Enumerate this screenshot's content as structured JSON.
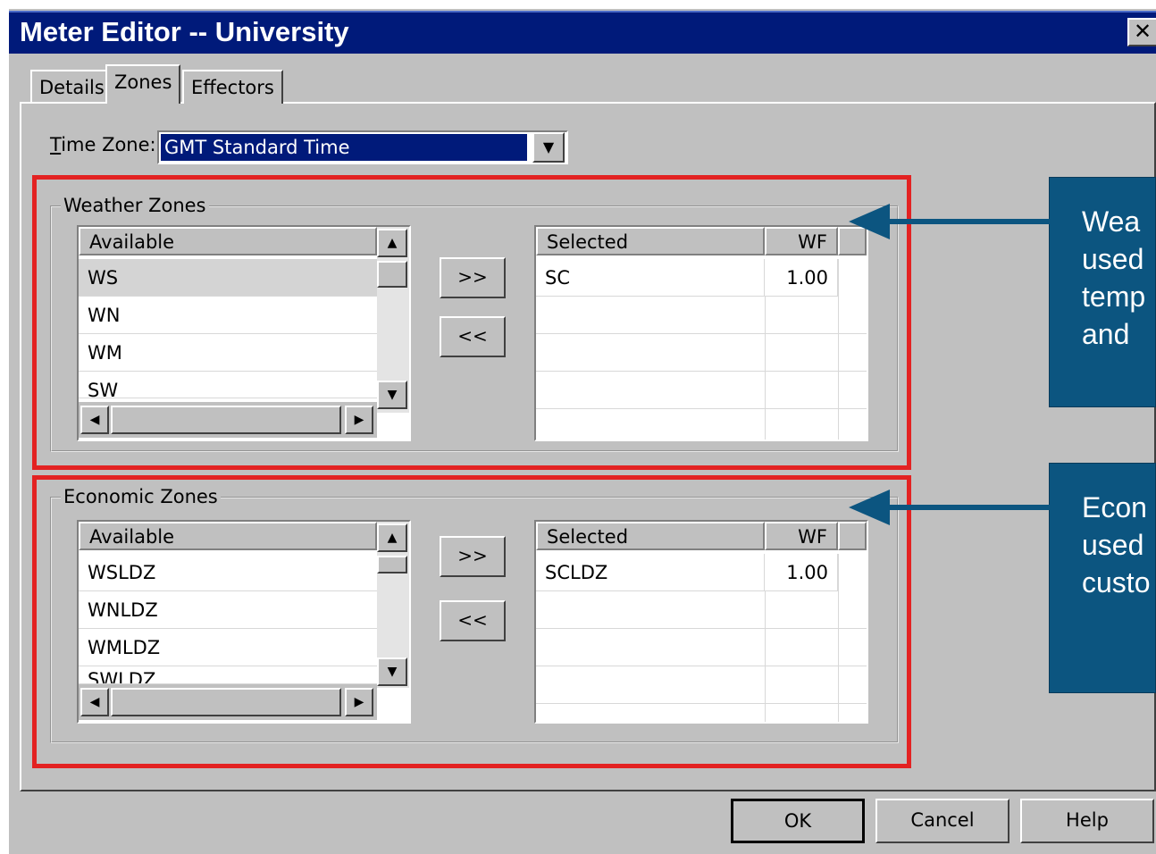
{
  "window": {
    "title": "Meter Editor -- University",
    "close_glyph": "✕"
  },
  "tabs": [
    "Details",
    "Zones",
    "Effectors"
  ],
  "time_zone": {
    "label_accel": "T",
    "label_rest": "ime Zone:",
    "value": "GMT Standard Time"
  },
  "weather": {
    "group_label": "Weather Zones",
    "available_header": "Available",
    "available": [
      "WS",
      "WN",
      "WM",
      "SW"
    ],
    "selected_header": "Selected",
    "wf_header": "WF",
    "selected": [
      {
        "name": "SC",
        "wf": "1.00"
      }
    ]
  },
  "economic": {
    "group_label": "Economic Zones",
    "available_header": "Available",
    "available": [
      "WSLDZ",
      "WNLDZ",
      "WMLDZ",
      "SWLDZ"
    ],
    "selected_header": "Selected",
    "wf_header": "WF",
    "selected": [
      {
        "name": "SCLDZ",
        "wf": "1.00"
      }
    ]
  },
  "move_buttons": {
    "add": ">>",
    "remove": "<<"
  },
  "dialog_buttons": {
    "ok": "OK",
    "cancel": "Cancel",
    "help": "Help"
  },
  "callouts": {
    "weather": [
      "Wea",
      "used",
      "temp",
      "and"
    ],
    "economic": [
      "Econ",
      "used",
      "custo"
    ]
  },
  "colors": {
    "title_bar": "#001a7a",
    "highlight_box": "#e32222",
    "callout_bg": "#0c5580",
    "arrow": "#0c5580"
  },
  "icons": [
    "close-icon",
    "dropdown-arrow-icon",
    "scroll-up-icon",
    "scroll-down-icon",
    "scroll-left-icon",
    "scroll-right-icon",
    "arrow-left-icon"
  ]
}
